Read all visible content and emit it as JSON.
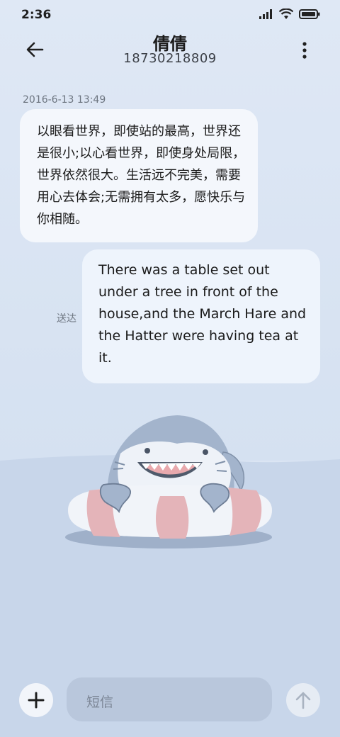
{
  "status_bar": {
    "time": "2:36"
  },
  "header": {
    "contact_name": "倩倩",
    "phone_number": "18730218809"
  },
  "conversation": {
    "timestamp": "2016-6-13 13:49",
    "messages": [
      {
        "direction": "incoming",
        "text": "以眼看世界，即使站的最高，世界还是很小;以心看世界，即使身处局限，世界依然很大。生活远不完美，需要用心去体会;无需拥有太多，愿快乐与你相随。"
      },
      {
        "direction": "outgoing",
        "text": "There was a table set out under a tree in front of the house,and the March Hare and the Hatter were having tea at it.",
        "status": "送达"
      }
    ]
  },
  "composer": {
    "placeholder": "短信"
  },
  "icons": {
    "back": "arrow-left-icon",
    "more": "more-vertical-icon",
    "add": "plus-icon",
    "send": "arrow-up-icon",
    "signal": "signal-icon",
    "wifi": "wifi-icon",
    "battery": "battery-icon"
  }
}
